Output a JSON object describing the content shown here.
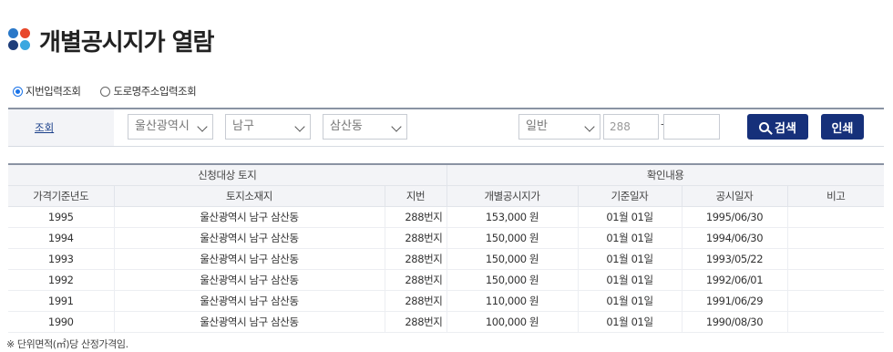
{
  "page": {
    "title": "개별공시지가 열람"
  },
  "radios": [
    {
      "label": "지번입력조회",
      "checked": true
    },
    {
      "label": "도로명주소입력조회",
      "checked": false
    }
  ],
  "search": {
    "label": "조회",
    "city": "울산광역시",
    "district": "남구",
    "dong": "삼산동",
    "land_type": "일반",
    "main_number_placeholder": "288",
    "sub_number_placeholder": "",
    "separator": "-",
    "search_button": "검색",
    "print_button": "인쇄"
  },
  "table": {
    "group_headers": [
      "신청대상 토지",
      "확인내용"
    ],
    "columns": [
      "가격기준년도",
      "토지소재지",
      "지번",
      "개별공시지가",
      "기준일자",
      "공시일자",
      "비고"
    ],
    "rows": [
      [
        "1995",
        "울산광역시 남구 삼산동",
        "288번지",
        "153,000 원",
        "01월 01일",
        "1995/06/30",
        ""
      ],
      [
        "1994",
        "울산광역시 남구 삼산동",
        "288번지",
        "150,000 원",
        "01월 01일",
        "1994/06/30",
        ""
      ],
      [
        "1993",
        "울산광역시 남구 삼산동",
        "288번지",
        "150,000 원",
        "01월 01일",
        "1993/05/22",
        ""
      ],
      [
        "1992",
        "울산광역시 남구 삼산동",
        "288번지",
        "150,000 원",
        "01월 01일",
        "1992/06/01",
        ""
      ],
      [
        "1991",
        "울산광역시 남구 삼산동",
        "288번지",
        "110,000 원",
        "01월 01일",
        "1991/06/29",
        ""
      ],
      [
        "1990",
        "울산광역시 남구 삼산동",
        "288번지",
        "100,000 원",
        "01월 01일",
        "1990/08/30",
        ""
      ]
    ]
  },
  "footnote": "※ 단위면적(㎡)당 산정가격임.",
  "colors": {
    "primary_button": "#16307a",
    "radio_accent": "#1a73e8"
  }
}
